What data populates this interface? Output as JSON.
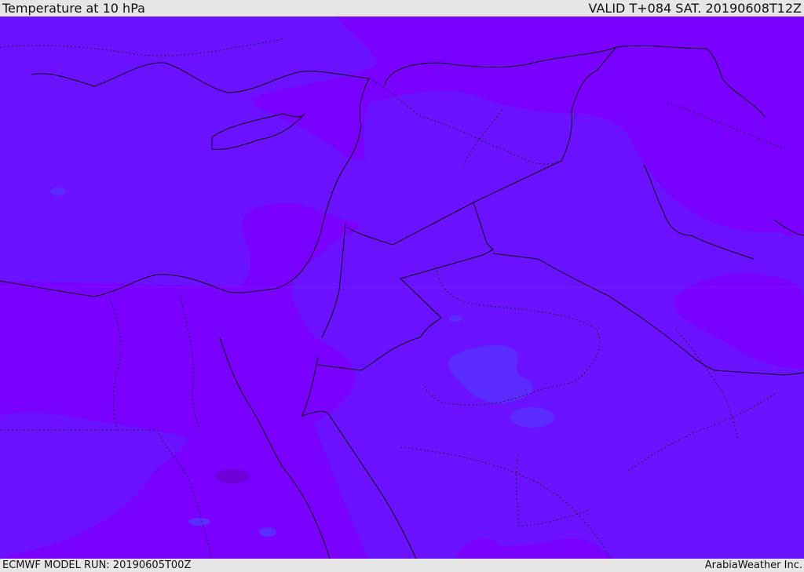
{
  "header": {
    "title": "Temperature at 10 hPa",
    "valid": "VALID T+084 SAT. 20190608T12Z"
  },
  "footer": {
    "model_run": "ECMWF MODEL RUN: 20190605T00Z",
    "credit": "ArabiaWeather Inc."
  },
  "colors": {
    "warm_violet": "#7a00ff",
    "mid_violet": "#6a12ff",
    "cool_violet": "#5a2cff",
    "deep_violet": "#7000d8",
    "border": "#111111",
    "frame": "#e6e6e6"
  }
}
